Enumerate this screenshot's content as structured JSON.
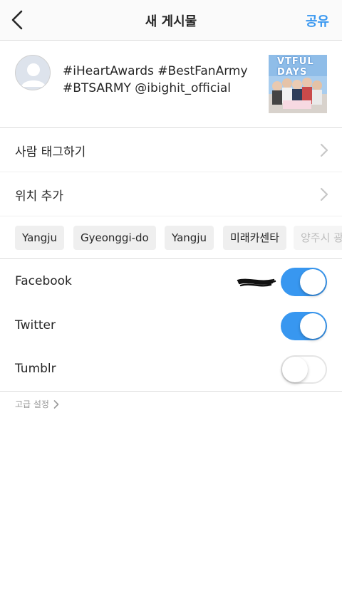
{
  "header": {
    "title": "새 게시물",
    "share_label": "공유",
    "back_icon": "chevron-left-icon"
  },
  "post": {
    "caption": "#iHeartAwards #BestFanArmy #BTSARMY @ibighit_official",
    "thumbnail_text": "VTFUL DAYS"
  },
  "menu": {
    "tag_people": "사람 태그하기",
    "add_location": "위치 추가"
  },
  "location_chips": [
    "Yangju",
    "Gyeonggi-do",
    "Yangju",
    "미래카센타",
    "양주시 광"
  ],
  "share_targets": [
    {
      "label": "Facebook",
      "enabled": true
    },
    {
      "label": "Twitter",
      "enabled": true
    },
    {
      "label": "Tumblr",
      "enabled": false
    }
  ],
  "advanced_settings": "고급 설정",
  "colors": {
    "accent": "#3897f0",
    "border": "#dbdbdb",
    "chip_bg": "#efefef"
  }
}
